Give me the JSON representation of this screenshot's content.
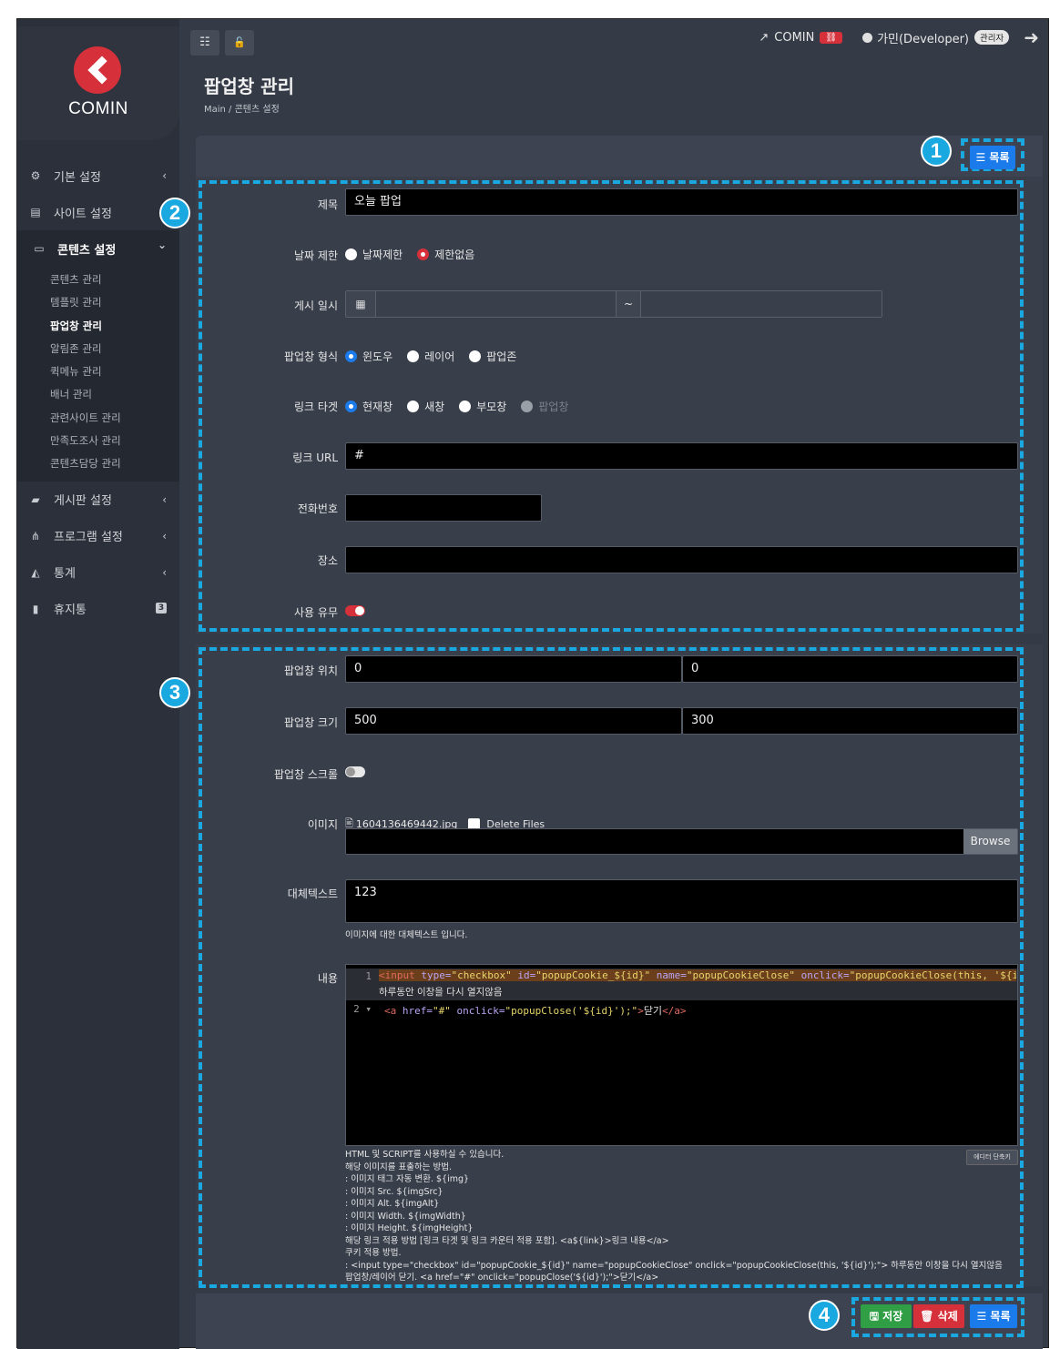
{
  "app": {
    "logo_text": "COMIN"
  },
  "sidebar": {
    "items": [
      {
        "icon": "gears-icon",
        "glyph": "⚙",
        "label": "기본 설정",
        "chevron": "‹"
      },
      {
        "icon": "list-icon",
        "glyph": "▤",
        "label": "사이트 설정"
      },
      {
        "icon": "folder-icon",
        "glyph": "▭",
        "label": "콘텐츠 설정",
        "chevron": "⌄"
      },
      {
        "icon": "comments-icon",
        "glyph": "▰",
        "label": "게시판 설정",
        "chevron": "‹"
      },
      {
        "icon": "sitemap-icon",
        "glyph": "⋔",
        "label": "프로그램 설정",
        "chevron": "‹"
      },
      {
        "icon": "chart-icon",
        "glyph": "◭",
        "label": "통계",
        "chevron": "‹"
      },
      {
        "icon": "trash-icon",
        "glyph": "▮",
        "label": "휴지통",
        "badge": "3"
      }
    ],
    "sub_items": [
      "콘텐츠 관리",
      "템플릿 관리",
      "팝업창 관리",
      "알림존 관리",
      "퀵메뉴 관리",
      "배너 관리",
      "관련사이트 관리",
      "만족도조사 관리",
      "콘텐츠담당 관리"
    ]
  },
  "topbar": {
    "site_link": "COMIN",
    "user": "가민(Developer)",
    "role": "관리자",
    "btn1_glyph": "☷",
    "btn2_glyph": "🔓"
  },
  "page": {
    "title": "팝업창 관리",
    "breadcrumb": "Main  /  콘텐츠 설정"
  },
  "buttons": {
    "list": "목록",
    "save": "저장",
    "delete": "삭제"
  },
  "markers": {
    "m1": "1",
    "m2": "2",
    "m3": "3",
    "m4": "4"
  },
  "form": {
    "title_label": "제목",
    "title_value": "오늘 팝업",
    "date_limit_label": "날짜 제한",
    "date_limit_options": [
      "날짜제한",
      "제한없음"
    ],
    "post_date_label": "게시 일시",
    "date_sep": "~",
    "popup_type_label": "팝업창 형식",
    "popup_type_options": [
      "윈도우",
      "레이어",
      "팝업존"
    ],
    "link_target_label": "링크 타겟",
    "link_target_options": [
      "현재창",
      "새창",
      "부모창",
      "팝업창"
    ],
    "link_url_label": "링크 URL",
    "link_url_value": "#",
    "phone_label": "전화번호",
    "place_label": "장소",
    "use_label": "사용 유무",
    "position_label": "팝업창 위치",
    "position_x": "0",
    "position_y": "0",
    "size_label": "팝업창 크기",
    "size_w": "500",
    "size_h": "300",
    "scroll_label": "팝업창 스크롤",
    "image_label": "이미지",
    "image_file": "1604136469442.jpg",
    "delete_files": "Delete Files",
    "browse": "Browse",
    "alt_label": "대체텍스트",
    "alt_value": "123",
    "alt_help": "이미지에 대한 대체텍스트 입니다.",
    "content_label": "내용",
    "editor_toggle": "에디터 단축키",
    "code_line1_num": "1",
    "code_line2_num": "2 ▾",
    "code_line1_wrap": "하루동안 이창을 다시 열지않음",
    "help_lines": [
      "HTML 및 SCRIPT를 사용하실 수 있습니다.",
      "해당 이미지를 표출하는 방법.",
      ": 이미지 태그 자동 변환. ${img}",
      ": 이미지 Src. ${imgSrc}",
      ": 이미지 Alt. ${imgAlt}",
      ": 이미지 Width. ${imgWidth}",
      ": 이미지 Height. ${imgHeight}",
      "해당 링크 적용 방법 [링크 타겟 및 링크 카운터 적용 포함]. <a${link}>링크 내용</a>",
      "쿠키 적용 방법.",
      ": <input type=\"checkbox\" id=\"popupCookie_${id}\" name=\"popupCookieClose\" onclick=\"popupCookieClose(this, '${id}');\"> 하루동안 이창을 다시 열지않음",
      "팝업창/레이어 닫기. <a href=\"#\" onclick=\"popupClose('${id}');\">닫기</a>"
    ]
  },
  "colors": {
    "accent": "#19a8e0",
    "primary": "#1b7bea",
    "danger": "#d6303b",
    "success": "#2f9e44"
  }
}
